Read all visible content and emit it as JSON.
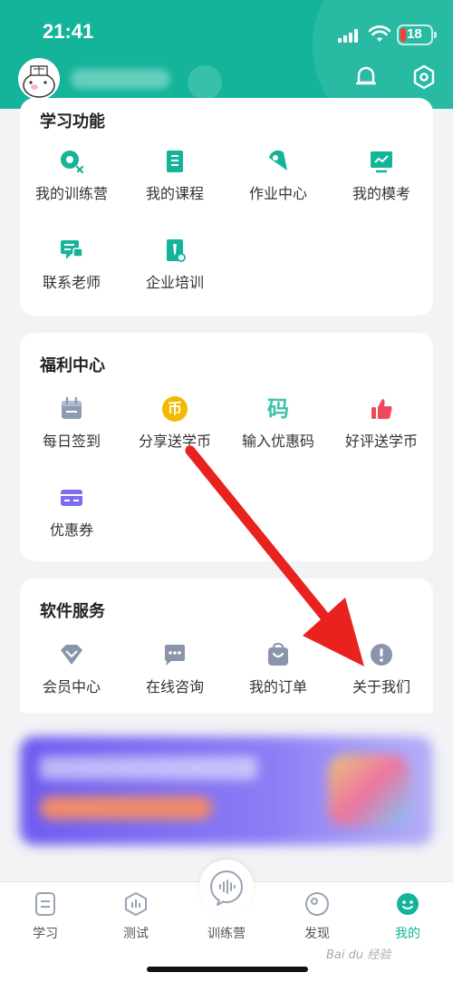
{
  "status_bar": {
    "time": "21:41",
    "battery": "18"
  },
  "sections": [
    {
      "title": "学习功能",
      "items": [
        {
          "label": "我的训练营",
          "icon": "camp-icon"
        },
        {
          "label": "我的课程",
          "icon": "course-book-icon"
        },
        {
          "label": "作业中心",
          "icon": "homework-icon"
        },
        {
          "label": "我的模考",
          "icon": "mock-exam-icon"
        },
        {
          "label": "联系老师",
          "icon": "chat-teacher-icon"
        },
        {
          "label": "企业培训",
          "icon": "enterprise-training-icon"
        }
      ]
    },
    {
      "title": "福利中心",
      "items": [
        {
          "label": "每日签到",
          "icon": "calendar-checkin-icon"
        },
        {
          "label": "分享送学币",
          "icon": "coin-icon"
        },
        {
          "label": "输入优惠码",
          "icon": "promo-code-icon"
        },
        {
          "label": "好评送学币",
          "icon": "thumbs-up-icon"
        },
        {
          "label": "优惠券",
          "icon": "coupon-icon"
        }
      ]
    },
    {
      "title": "软件服务",
      "items": [
        {
          "label": "会员中心",
          "icon": "diamond-icon"
        },
        {
          "label": "在线咨询",
          "icon": "message-icon"
        },
        {
          "label": "我的订单",
          "icon": "order-bag-icon"
        },
        {
          "label": "关于我们",
          "icon": "info-icon"
        }
      ]
    }
  ],
  "coin_glyph": "币",
  "code_glyph": "码",
  "tabs": [
    {
      "label": "学习",
      "icon": "study-icon"
    },
    {
      "label": "测试",
      "icon": "test-icon"
    },
    {
      "label": "训练营",
      "icon": "camp-voice-icon"
    },
    {
      "label": "发现",
      "icon": "discover-icon"
    },
    {
      "label": "我的",
      "icon": "profile-face-icon",
      "active": true
    }
  ],
  "colors": {
    "brand": "#14b49a",
    "arrow": "#e8231f",
    "coupon": "#7b6cf0",
    "like": "#f04a5a",
    "coin": "#f5b800",
    "info": "#8a94ab"
  },
  "watermark": "Bai du 经验"
}
